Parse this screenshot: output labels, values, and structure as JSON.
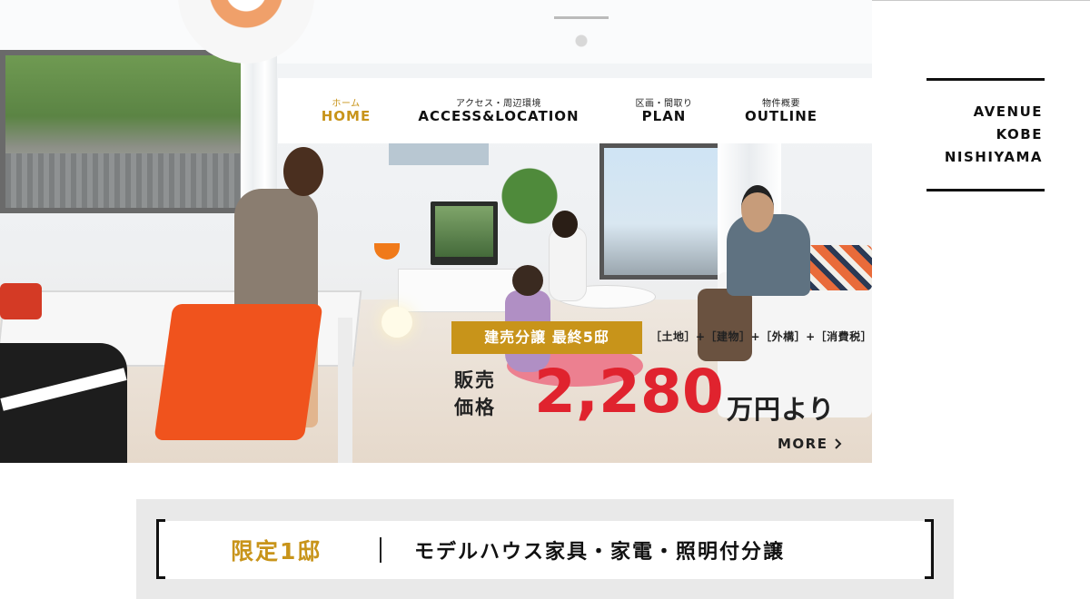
{
  "nav": {
    "items": [
      {
        "jp": "ホーム",
        "en": "HOME",
        "active": true
      },
      {
        "jp": "アクセス・周辺環境",
        "en": "ACCESS&LOCATION",
        "active": false
      },
      {
        "jp": "区画・間取り",
        "en": "PLAN",
        "active": false
      },
      {
        "jp": "物件概要",
        "en": "OUTLINE",
        "active": false
      }
    ]
  },
  "logo": {
    "line1": "AVENUE",
    "line2": "KOBE",
    "line3": "NISHIYAMA"
  },
  "hero": {
    "image": "living-room-family-photo",
    "sale_badge": "建売分譲 最終5邸",
    "price_note": "［土地］+［建物］+［外構］+［消費税］",
    "price_label_line1": "販売",
    "price_label_line2": "価格",
    "price_value": "2,280",
    "price_unit": "万円より",
    "more_label": "MORE",
    "more_icon": "chevron-right-icon"
  },
  "banner": {
    "limited_text": "限定1邸",
    "headline": "モデルハウス家具・家電・照明付分譲"
  },
  "colors": {
    "accent_gold": "#c8941a",
    "price_red": "#e0232e",
    "banner_bg": "#e9e9e9"
  }
}
